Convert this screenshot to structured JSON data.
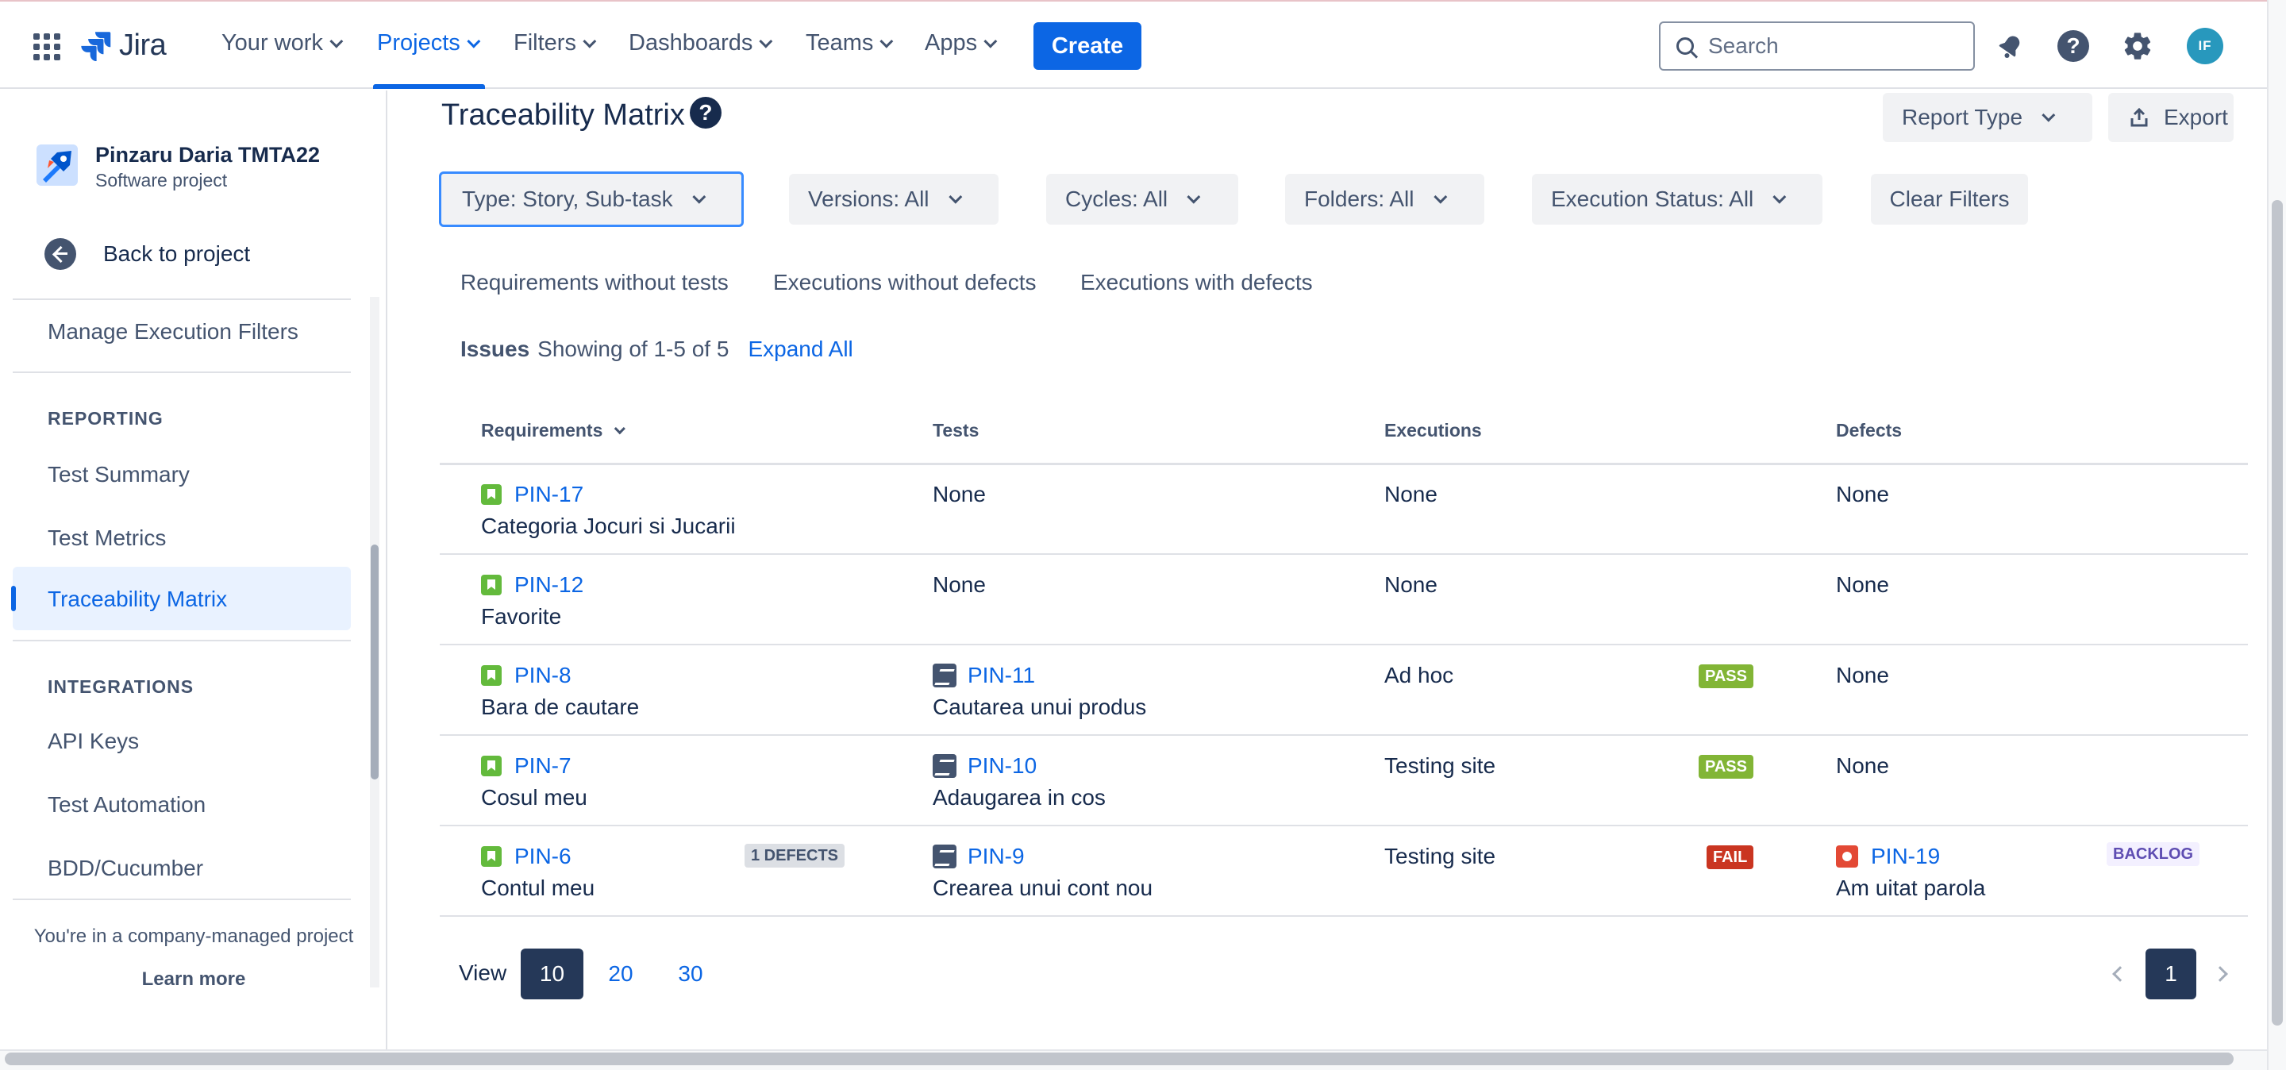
{
  "topnav": {
    "logo_text": "Jira",
    "items": [
      {
        "label": "Your work"
      },
      {
        "label": "Projects"
      },
      {
        "label": "Filters"
      },
      {
        "label": "Dashboards"
      },
      {
        "label": "Teams"
      },
      {
        "label": "Apps"
      }
    ],
    "create_label": "Create",
    "search_placeholder": "Search",
    "avatar_initials": "IF",
    "active_item": "Projects"
  },
  "sidebar": {
    "project_name": "Pinzaru Daria TMTA22",
    "project_type": "Software project",
    "back_label": "Back to project",
    "manage_label": "Manage Execution Filters",
    "reporting_heading": "REPORTING",
    "reporting_items": [
      "Test Summary",
      "Test Metrics",
      "Traceability Matrix"
    ],
    "selected_item": "Traceability Matrix",
    "integrations_heading": "INTEGRATIONS",
    "integration_items": [
      "API Keys",
      "Test Automation",
      "BDD/Cucumber"
    ],
    "footer_text": "You're in a company-managed project",
    "learn_more": "Learn more"
  },
  "main": {
    "title": "Traceability Matrix",
    "help_glyph": "?",
    "report_type_label": "Report Type",
    "export_label": "Export",
    "filters": {
      "type": "Type: Story, Sub-task",
      "versions": "Versions: All",
      "cycles": "Cycles: All",
      "folders": "Folders: All",
      "execution_status": "Execution Status: All",
      "clear": "Clear Filters"
    },
    "tabs": [
      "Requirements without tests",
      "Executions without defects",
      "Executions with defects"
    ],
    "issues_label": "Issues",
    "showing_text": "Showing of 1-5 of 5",
    "expand_all": "Expand All"
  },
  "table": {
    "headers": {
      "requirements": "Requirements",
      "tests": "Tests",
      "executions": "Executions",
      "defects": "Defects"
    },
    "rows": [
      {
        "req_key": "PIN-17",
        "req_title": "Categoria Jocuri si Jucarii",
        "req_badge": "",
        "test_key": "",
        "test_title": "",
        "test_none": "None",
        "exec": "None",
        "exec_status": "",
        "defect_key": "",
        "defect_title": "",
        "defect_none": "None",
        "defect_status": ""
      },
      {
        "req_key": "PIN-12",
        "req_title": "Favorite",
        "req_badge": "",
        "test_key": "",
        "test_title": "",
        "test_none": "None",
        "exec": "None",
        "exec_status": "",
        "defect_key": "",
        "defect_title": "",
        "defect_none": "None",
        "defect_status": ""
      },
      {
        "req_key": "PIN-8",
        "req_title": "Bara de cautare",
        "req_badge": "",
        "test_key": "PIN-11",
        "test_title": "Cautarea unui produs",
        "test_none": "",
        "exec": "Ad hoc",
        "exec_status": "PASS",
        "defect_key": "",
        "defect_title": "",
        "defect_none": "None",
        "defect_status": ""
      },
      {
        "req_key": "PIN-7",
        "req_title": "Cosul meu",
        "req_badge": "",
        "test_key": "PIN-10",
        "test_title": "Adaugarea in cos",
        "test_none": "",
        "exec": "Testing site",
        "exec_status": "PASS",
        "defect_key": "",
        "defect_title": "",
        "defect_none": "None",
        "defect_status": ""
      },
      {
        "req_key": "PIN-6",
        "req_title": "Contul meu",
        "req_badge": "1 DEFECTS",
        "test_key": "PIN-9",
        "test_title": "Crearea unui cont nou",
        "test_none": "",
        "exec": "Testing site",
        "exec_status": "FAIL",
        "defect_key": "PIN-19",
        "defect_title": "Am uitat parola",
        "defect_none": "",
        "defect_status": "BACKLOG"
      }
    ]
  },
  "pagination": {
    "view_label": "View",
    "sizes": [
      "10",
      "20",
      "30"
    ],
    "selected_size": "10",
    "current_page": "1"
  },
  "colors": {
    "accent": "#0c66e4",
    "pass": "#82b536",
    "fail": "#ca3521",
    "story": "#63ba3c",
    "bug": "#e34935"
  }
}
